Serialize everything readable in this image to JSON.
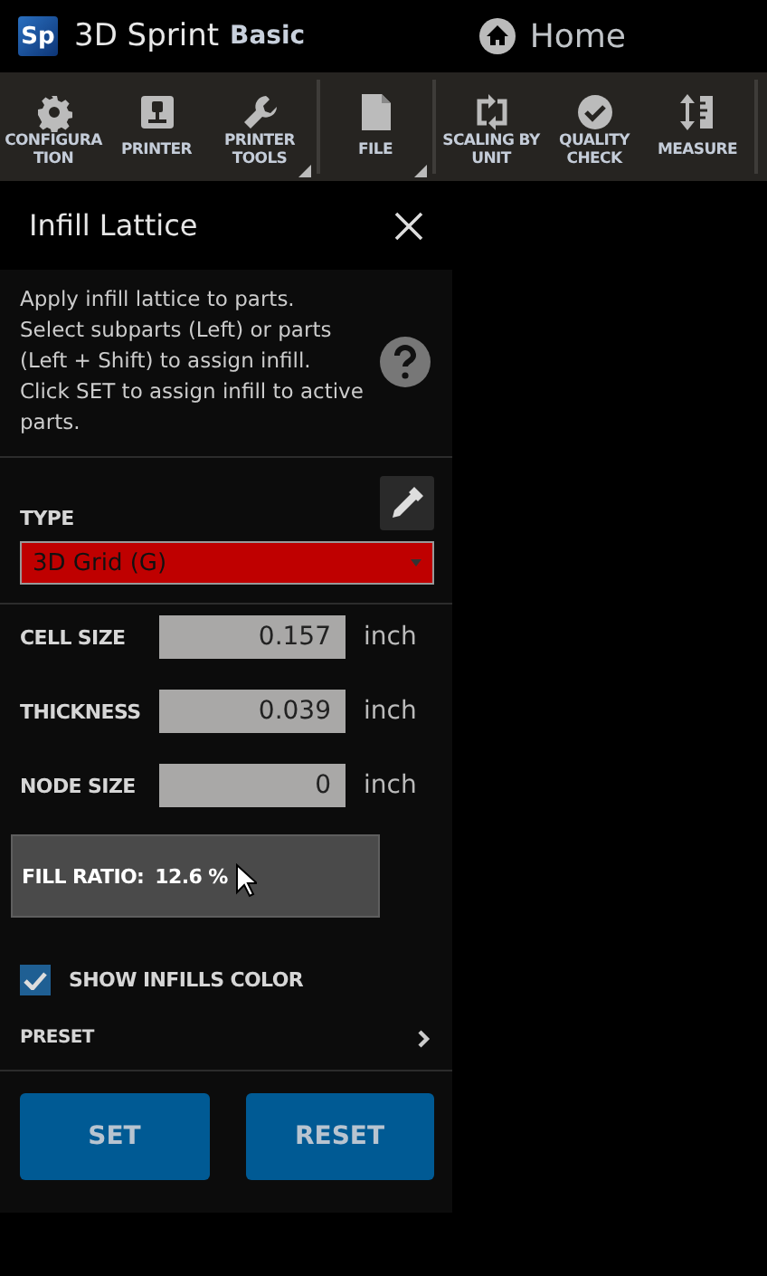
{
  "app": {
    "logo": "Sp",
    "name": "3D Sprint",
    "edition": "Basic",
    "location": "Home"
  },
  "toolbar": [
    {
      "label": "CONFIGURA\nTION",
      "has_menu": false,
      "divider_after": false
    },
    {
      "label": "PRINTER",
      "has_menu": false,
      "divider_after": false
    },
    {
      "label": "PRINTER\nTOOLS",
      "has_menu": true,
      "divider_after": true
    },
    {
      "label": "FILE",
      "has_menu": true,
      "divider_after": true
    },
    {
      "label": "SCALING BY\nUNIT",
      "has_menu": false,
      "divider_after": false
    },
    {
      "label": "QUALITY\nCHECK",
      "has_menu": false,
      "divider_after": false
    },
    {
      "label": "MEASURE",
      "has_menu": false,
      "divider_after": true
    }
  ],
  "panel": {
    "title": "Infill Lattice",
    "description": "Apply infill lattice to parts.\nSelect subparts (Left) or parts (Left + Shift) to assign infill.\nClick SET to assign infill to active parts.",
    "type_label": "TYPE",
    "type_value": "3D Grid (G)",
    "fields": [
      {
        "label": "CELL SIZE",
        "value": "0.157",
        "unit": "inch"
      },
      {
        "label": "THICKNESS",
        "value": "0.039",
        "unit": "inch"
      },
      {
        "label": "NODE SIZE",
        "value": "0",
        "unit": "inch"
      }
    ],
    "fill_ratio": {
      "label": "FILL RATIO:",
      "value": "12.6 %"
    },
    "show_infills_color": {
      "label": "SHOW INFILLS COLOR",
      "checked": true
    },
    "preset": {
      "label": "PRESET"
    },
    "buttons": [
      "SET",
      "RESET"
    ]
  }
}
